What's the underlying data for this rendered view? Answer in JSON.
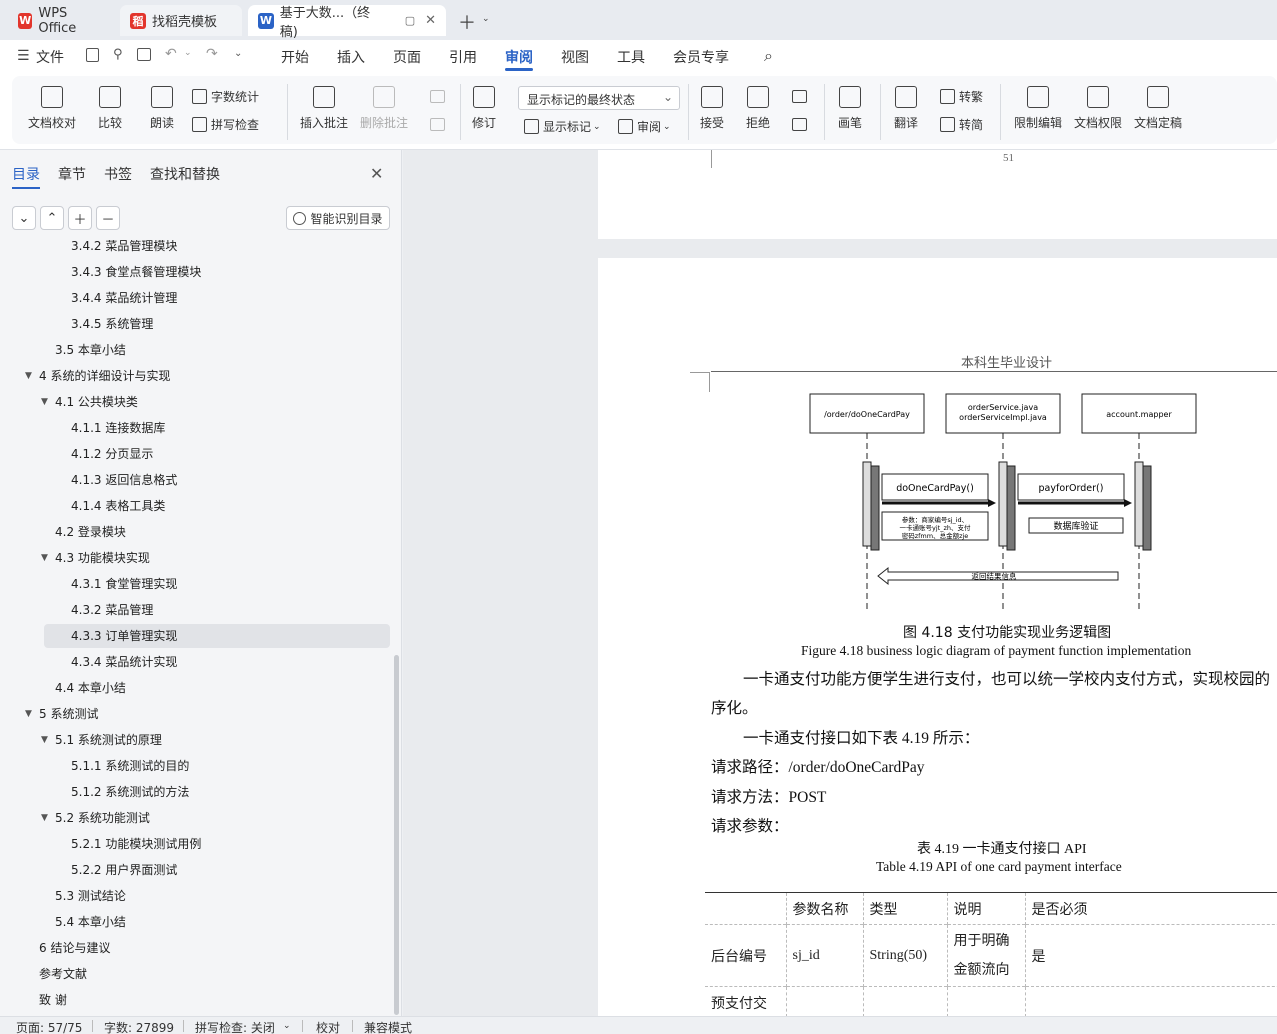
{
  "tabs": [
    {
      "label": "WPS Office",
      "icon": "wps-logo-icon"
    },
    {
      "label": "找稻壳模板",
      "icon": "docer-icon"
    },
    {
      "label": "基于大数...（终稿)",
      "icon": "word-doc-icon"
    }
  ],
  "menu": {
    "file": "文件",
    "items": [
      "开始",
      "插入",
      "页面",
      "引用",
      "审阅",
      "视图",
      "工具",
      "会员专享"
    ],
    "active": "审阅"
  },
  "ribbon": {
    "doc_check": "文档校对",
    "compare": "比较",
    "read_aloud": "朗读",
    "word_count": "字数统计",
    "spell_check": "拼写检查",
    "insert_comment": "插入批注",
    "delete_comment": "删除批注",
    "track_changes": "修订",
    "markup_state": "显示标记的最终状态",
    "show_markup": "显示标记",
    "review": "审阅",
    "accept": "接受",
    "reject": "拒绝",
    "ink": "画笔",
    "translate": "翻译",
    "to_traditional": "转繁",
    "to_simplified": "转简",
    "restrict_edit": "限制编辑",
    "doc_permission": "文档权限",
    "finalize": "文档定稿"
  },
  "nav": {
    "tabs": [
      "目录",
      "章节",
      "书签",
      "查找和替换"
    ],
    "smart_toc": "智能识别目录",
    "toc": [
      {
        "level": 3,
        "label": "3.4.2  菜品管理模块"
      },
      {
        "level": 3,
        "label": "3.4.3  食堂点餐管理模块"
      },
      {
        "level": 3,
        "label": "3.4.4  菜品统计管理"
      },
      {
        "level": 3,
        "label": "3.4.5  系统管理"
      },
      {
        "level": 2,
        "label": "3.5  本章小结"
      },
      {
        "level": 1,
        "label": "4  系统的详细设计与实现",
        "expanded": true
      },
      {
        "level": 2,
        "label": "4.1  公共模块类",
        "expanded": true
      },
      {
        "level": 3,
        "label": "4.1.1  连接数据库"
      },
      {
        "level": 3,
        "label": "4.1.2  分页显示"
      },
      {
        "level": 3,
        "label": "4.1.3  返回信息格式"
      },
      {
        "level": 3,
        "label": "4.1.4  表格工具类"
      },
      {
        "level": 2,
        "label": "4.2  登录模块"
      },
      {
        "level": 2,
        "label": "4.3  功能模块实现",
        "expanded": true
      },
      {
        "level": 3,
        "label": "4.3.1  食堂管理实现"
      },
      {
        "level": 3,
        "label": "4.3.2  菜品管理"
      },
      {
        "level": 3,
        "label": "4.3.3  订单管理实现",
        "selected": true
      },
      {
        "level": 3,
        "label": "4.3.4  菜品统计实现"
      },
      {
        "level": 2,
        "label": "4.4  本章小结"
      },
      {
        "level": 1,
        "label": "5  系统测试",
        "expanded": true
      },
      {
        "level": 2,
        "label": "5.1  系统测试的原理",
        "expanded": true
      },
      {
        "level": 3,
        "label": "5.1.1  系统测试的目的"
      },
      {
        "level": 3,
        "label": "5.1.2  系统测试的方法"
      },
      {
        "level": 2,
        "label": "5.2  系统功能测试",
        "expanded": true
      },
      {
        "level": 3,
        "label": "5.2.1  功能模块测试用例"
      },
      {
        "level": 3,
        "label": "5.2.2  用户界面测试"
      },
      {
        "level": 2,
        "label": "5.3  测试结论"
      },
      {
        "level": 2,
        "label": "5.4  本章小结"
      },
      {
        "level": 1,
        "label": "6 结论与建议"
      },
      {
        "level": 1,
        "label": "参考文献"
      },
      {
        "level": 1,
        "label": "致    谢"
      }
    ]
  },
  "document": {
    "prev_page_number": "51",
    "header": "本科生毕业设计",
    "diagram": {
      "lifelines": [
        "/order/doOneCardPay",
        "orderService.java\norderServiceImpl.java",
        "account.mapper"
      ],
      "msg1": "doOneCardPay()",
      "params": "参数：商家编号sj_id、一卡通账号yjt_zh、支付密码zfmm、总金额zje",
      "msg2": "payforOrder()",
      "db_check": "数据库验证",
      "return": "返回结果信息"
    },
    "fig_caption_cn": "图  4.18 支付功能实现业务逻辑图",
    "fig_caption_en": "Figure 4.18 business logic diagram of payment function implementation",
    "para1": "一卡通支付功能方便学生进行支付，也可以统一学校内支付方式，实现校园的",
    "para1_cont": "序化。",
    "para2": "一卡通支付接口如下表 4.19 所示：",
    "path": "请求路径：/order/doOneCardPay",
    "method": "请求方法：POST",
    "params_label": "请求参数：",
    "table_caption_cn": "表 4.19  一卡通支付接口 API",
    "table_caption_en": "Table 4.19 API of one card payment interface",
    "table_headers": [
      "",
      "参数名称",
      "类型",
      "说明",
      "是否必须"
    ],
    "table_rows": [
      [
        "后台编号",
        "sj_id",
        "String(50)",
        "用于明确金额流向",
        "是"
      ],
      [
        "预支付交",
        "",
        "",
        "",
        ""
      ]
    ]
  },
  "status": {
    "page": "页面: 57/75",
    "words": "字数: 27899",
    "spell": "拼写检查: 关闭",
    "proof": "校对",
    "compat": "兼容模式"
  },
  "colors": {
    "accent": "#2b63c6",
    "wps_red": "#e2352c"
  }
}
